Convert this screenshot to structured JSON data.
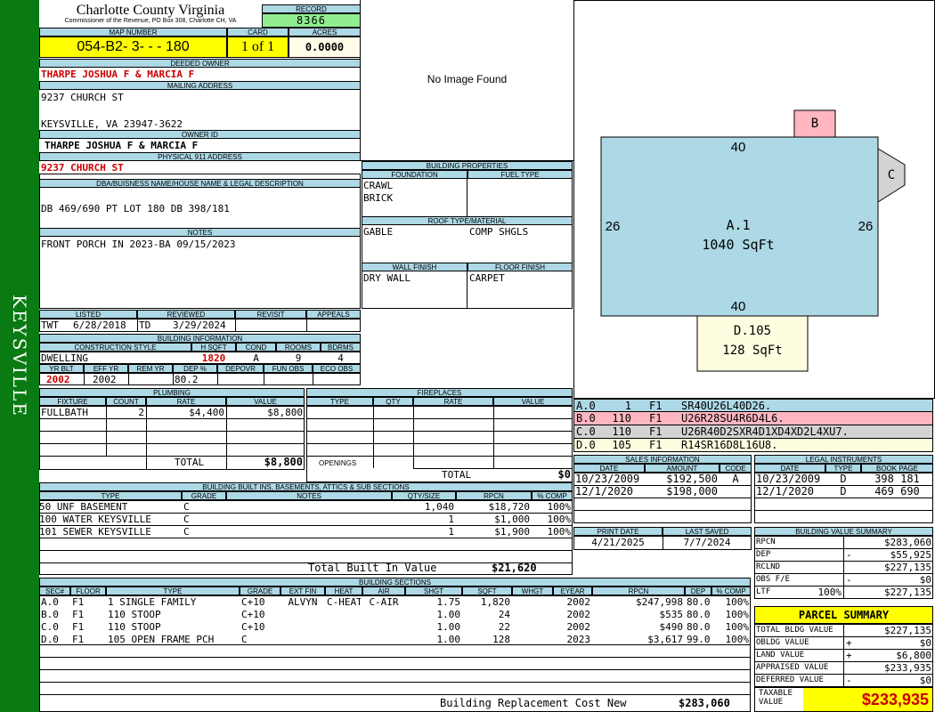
{
  "sidebar_text": "KEYSVILLE",
  "county": {
    "title": "Charlotte County Virginia",
    "subtitle": "Commissioner of the Revenue, PO Box 308, Charlotte CH, VA"
  },
  "record": {
    "label": "RECORD",
    "value": "8366"
  },
  "map": {
    "label": "MAP NUMBER",
    "value": "054-B2- 3-   -   - 180"
  },
  "card": {
    "label": "CARD",
    "value": "1 of 1"
  },
  "acres": {
    "label": "ACRES",
    "value": "0.0000"
  },
  "deeded_owner": {
    "label": "DEEDED OWNER",
    "value": "THARPE JOSHUA F & MARCIA F"
  },
  "mailing": {
    "label": "MAILING ADDRESS",
    "line1": "9237 CHURCH ST",
    "line2": "KEYSVILLE, VA 23947-3622"
  },
  "owner_id": {
    "label": "OWNER ID",
    "value": "THARPE JOSHUA F & MARCIA F"
  },
  "physical": {
    "label": "PHYSICAL 911 ADDRESS",
    "value": "9237 CHURCH ST"
  },
  "dba": {
    "label": "DBA/BUISNESS NAME/HOUSE NAME & LEGAL DESCRIPTION",
    "value": "DB 469/690 PT LOT 180  DB 398/181"
  },
  "notes": {
    "label": "NOTES",
    "value": "FRONT PORCH IN 2023-BA 09/15/2023"
  },
  "image_text": "No Image Found",
  "building_props": {
    "label": "BUILDING PROPERTIES",
    "foundation_label": "FOUNDATION",
    "foundation": [
      "CRAWL",
      "BRICK"
    ],
    "fuel_label": "FUEL TYPE",
    "fuel": "",
    "roof_label": "ROOF TYPE/MATERIAL",
    "roof_type": "GABLE",
    "roof_material": "COMP SHGLS",
    "wall_label": "WALL FINISH",
    "wall": "DRY WALL",
    "floor_label": "FLOOR FINISH",
    "floor": "CARPET"
  },
  "listed": {
    "labels": [
      "LISTED",
      "REVIEWED",
      "REVISIT",
      "APPEALS"
    ],
    "listed_by": "TWT",
    "listed_date": "6/28/2018",
    "reviewed_by": "TD",
    "reviewed_date": "3/29/2024",
    "revisit": "",
    "appeals": ""
  },
  "building_info": {
    "label": "BUILDING INFORMATION",
    "headers": [
      "CONSTRUCTION STYLE",
      "H SQFT",
      "COND",
      "ROOMS",
      "BDRMS"
    ],
    "style": "DWELLING",
    "hsqft": "1820",
    "cond": "A",
    "rooms": "9",
    "bdrms": "4",
    "headers2": [
      "YR BLT",
      "EFF YR",
      "REM YR",
      "DEP %",
      "DEPOVR",
      "FUN OBS",
      "ECO OBS"
    ],
    "yr_blt": "2002",
    "eff_yr": "2002",
    "rem_yr": "",
    "dep": "80.2",
    "depovr": "",
    "fun_obs": "",
    "eco_obs": ""
  },
  "plumbing": {
    "label": "PLUMBING",
    "headers": [
      "FIXTURE",
      "COUNT",
      "RATE",
      "VALUE"
    ],
    "rows": [
      {
        "fixture": "FULLBATH",
        "count": "2",
        "rate": "$4,400",
        "value": "$8,800"
      }
    ],
    "total_label": "TOTAL",
    "total": "$8,800"
  },
  "fireplaces": {
    "label": "FIREPLACES",
    "headers": [
      "TYPE",
      "QTY",
      "RATE",
      "VALUE"
    ],
    "openings_label": "OPENINGS",
    "total_label": "TOTAL",
    "total": "$0"
  },
  "built_ins": {
    "label": "BUILDING BUILT INS, BASEMENTS, ATTICS & SUB SECTIONS",
    "headers": [
      "TYPE",
      "GRADE",
      "NOTES",
      "QTY/SIZE",
      "RPCN",
      "% COMP"
    ],
    "rows": [
      {
        "type": "50 UNF BASEMENT",
        "grade": "C",
        "notes": "",
        "qty": "1,040",
        "rpcn": "$18,720",
        "comp": "100%"
      },
      {
        "type": "100 WATER KEYSVILLE",
        "grade": "C",
        "notes": "",
        "qty": "1",
        "rpcn": "$1,000",
        "comp": "100%"
      },
      {
        "type": "101 SEWER KEYSVILLE",
        "grade": "C",
        "notes": "",
        "qty": "1",
        "rpcn": "$1,900",
        "comp": "100%"
      }
    ],
    "total_label": "Total Built In Value",
    "total": "$21,620"
  },
  "sections": {
    "label": "BUILDING SECTIONS",
    "headers": [
      "SEC#",
      "FLOOR",
      "TYPE",
      "GRADE",
      "EXT FIN",
      "HEAT",
      "AIR",
      "SHGT",
      "SQFT",
      "WHGT",
      "EYEAR",
      "RPCN",
      "DEP",
      "% COMP"
    ],
    "rows": [
      {
        "sec": "A.0",
        "floor": "F1",
        "type": "1 SINGLE FAMILY",
        "grade": "C+10",
        "ext": "ALVYN",
        "heat": "C-HEAT",
        "air": "C-AIR",
        "shgt": "1.75",
        "sqft": "1,820",
        "whgt": "",
        "eyear": "2002",
        "rpcn": "$247,998",
        "dep": "80.0",
        "comp": "100%"
      },
      {
        "sec": "B.0",
        "floor": "F1",
        "type": "110 STOOP",
        "grade": "C+10",
        "ext": "",
        "heat": "",
        "air": "",
        "shgt": "1.00",
        "sqft": "24",
        "whgt": "",
        "eyear": "2002",
        "rpcn": "$535",
        "dep": "80.0",
        "comp": "100%"
      },
      {
        "sec": "C.0",
        "floor": "F1",
        "type": "110 STOOP",
        "grade": "C+10",
        "ext": "",
        "heat": "",
        "air": "",
        "shgt": "1.00",
        "sqft": "22",
        "whgt": "",
        "eyear": "2002",
        "rpcn": "$490",
        "dep": "80.0",
        "comp": "100%"
      },
      {
        "sec": "D.0",
        "floor": "F1",
        "type": "105 OPEN FRAME PCH",
        "grade": "C",
        "ext": "",
        "heat": "",
        "air": "",
        "shgt": "1.00",
        "sqft": "128",
        "whgt": "",
        "eyear": "2023",
        "rpcn": "$3,617",
        "dep": "99.0",
        "comp": "100%"
      }
    ],
    "total_label": "Building Replacement Cost New",
    "total": "$283,060"
  },
  "sketch": {
    "a_label": "A.1",
    "a_area": "1040 SqFt",
    "top": "40",
    "bottom": "40",
    "left": "26",
    "right": "26",
    "b_label": "B",
    "c_label": "C",
    "d_label": "D.105",
    "d_area": "128 SqFt",
    "colors": {
      "main": "#add8e6",
      "b": "#ffb6c1",
      "c": "#d3d3d3",
      "d": "#fffde0"
    }
  },
  "sketch_legend": [
    {
      "sec": "A.0",
      "code": "1",
      "floor": "F1",
      "path": "SR40U26L40D26.",
      "color": "#add8e6"
    },
    {
      "sec": "B.0",
      "code": "110",
      "floor": "F1",
      "path": "U26R28SU4R6D4L6.",
      "color": "#ffb6c1"
    },
    {
      "sec": "C.0",
      "code": "110",
      "floor": "F1",
      "path": "U26R40D2SXR4D1XD4XD2L4XU7.",
      "color": "#d3d3d3"
    },
    {
      "sec": "D.0",
      "code": "105",
      "floor": "F1",
      "path": "R14SR16D8L16U8.",
      "color": "#fffde0"
    }
  ],
  "sales": {
    "label": "SALES INFORMATION",
    "headers": [
      "DATE",
      "AMOUNT",
      "CODE"
    ],
    "rows": [
      {
        "date": "10/23/2009",
        "amount": "$192,500",
        "code": "A"
      },
      {
        "date": "12/1/2020",
        "amount": "$198,000",
        "code": ""
      }
    ]
  },
  "legal": {
    "label": "LEGAL INSTRUMENTS",
    "headers": [
      "DATE",
      "TYPE",
      "BOOK PAGE"
    ],
    "rows": [
      {
        "date": "10/23/2009",
        "type": "D",
        "book": "398 181"
      },
      {
        "date": "12/1/2020",
        "type": "D",
        "book": "469 690"
      }
    ]
  },
  "print": {
    "print_label": "PRINT DATE",
    "print_date": "4/21/2025",
    "saved_label": "LAST SAVED",
    "saved_date": "7/7/2024"
  },
  "value_summary": {
    "label": "BUILDING VALUE SUMMARY",
    "rows": [
      {
        "label": "RPCN",
        "sign": "",
        "value": "$283,060"
      },
      {
        "label": "DEP",
        "sign": "-",
        "value": "$55,925"
      },
      {
        "label": "RCLND",
        "sign": "",
        "value": "$227,135"
      },
      {
        "label": "OBS F/E",
        "sign": "-",
        "value": "$0"
      },
      {
        "label": "LTF",
        "pct": "100%",
        "sign": "",
        "value": "$227,135"
      }
    ]
  },
  "parcel": {
    "label": "PARCEL SUMMARY",
    "rows": [
      {
        "label": "TOTAL BLDG VALUE",
        "sign": "",
        "value": "$227,135"
      },
      {
        "label": "OBLDG VALUE",
        "sign": "+",
        "value": "$0"
      },
      {
        "label": "LAND VALUE",
        "sign": "+",
        "value": "$6,800"
      },
      {
        "label": "APPRAISED VALUE",
        "sign": "",
        "value": "$233,935"
      },
      {
        "label": "DEFERRED VALUE",
        "sign": "-",
        "value": "$0"
      }
    ],
    "taxable_label_1": "TAXABLE",
    "taxable_label_2": "VALUE",
    "taxable": "$233,935"
  }
}
